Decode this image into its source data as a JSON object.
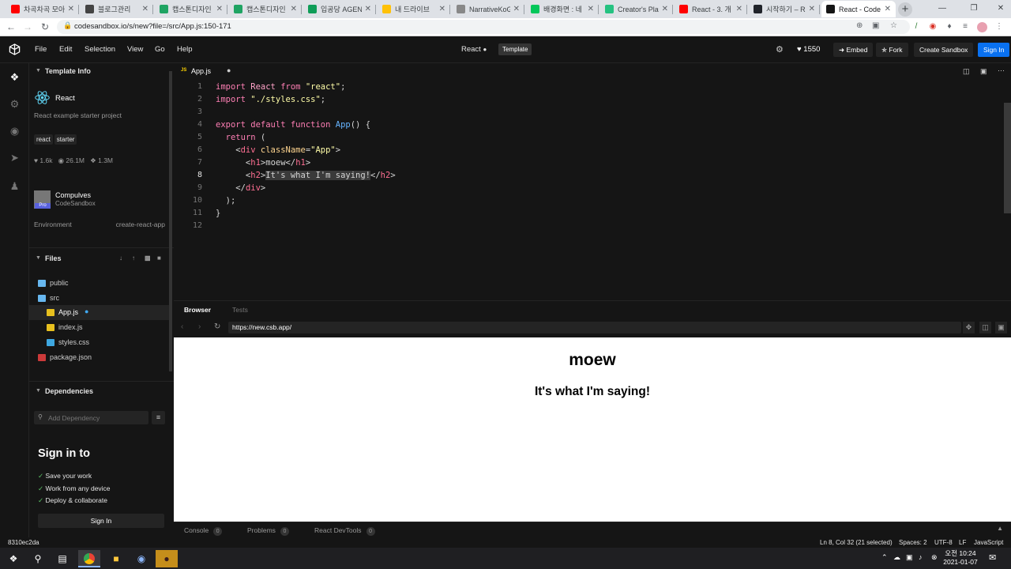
{
  "browser": {
    "tabs": [
      {
        "title": "차곡차곡 모아",
        "favicon": "youtube-icon",
        "color": "#ff0000"
      },
      {
        "title": "블로그관리",
        "favicon": "blog-icon",
        "color": "#444444"
      },
      {
        "title": "캡스톤디자인",
        "favicon": "google-drive-icon",
        "color": "#1fa463"
      },
      {
        "title": "캡스톤디자인",
        "favicon": "google-drive-icon",
        "color": "#1fa463"
      },
      {
        "title": "입공당 AGEN",
        "favicon": "google-sheets-icon",
        "color": "#0f9d58"
      },
      {
        "title": "내 드라이브",
        "favicon": "google-drive-icon",
        "color": "#ffc107"
      },
      {
        "title": "NarrativeKoG",
        "favicon": "github-icon",
        "color": "#888888"
      },
      {
        "title": "배경화면 : 네",
        "favicon": "naver-icon",
        "color": "#03c75a"
      },
      {
        "title": "Creator's Play",
        "favicon": "creator-icon",
        "color": "#25c281"
      },
      {
        "title": "React - 3. 개",
        "favicon": "youtube-icon",
        "color": "#ff0000"
      },
      {
        "title": "시작하기 – Re",
        "favicon": "react-docs-icon",
        "color": "#20232a"
      },
      {
        "title": "React - Code",
        "favicon": "codesandbox-icon",
        "color": "#151515",
        "active": true
      }
    ],
    "url": "codesandbox.io/s/new?file=/src/App.js:150-171"
  },
  "header": {
    "menu": [
      "File",
      "Edit",
      "Selection",
      "View",
      "Go",
      "Help"
    ],
    "sandbox_name": "React",
    "template_badge": "Template",
    "likes": "1550",
    "embed": "Embed",
    "fork": "Fork",
    "create_sandbox": "Create Sandbox",
    "sign_in": "Sign In"
  },
  "sidebar": {
    "template_info": {
      "heading": "Template Info",
      "name": "React",
      "description": "React example starter project",
      "tags": [
        "react",
        "starter"
      ],
      "stats": {
        "likes": "1.6k",
        "views": "26.1M",
        "forks": "1.3M"
      },
      "author": "Compulves",
      "author_sub": "CodeSandbox",
      "pro_badge": "Pro",
      "env_label": "Environment",
      "env_value": "create-react-app"
    },
    "files": {
      "heading": "Files",
      "items": [
        {
          "name": "public",
          "type": "folder"
        },
        {
          "name": "src",
          "type": "folder-open"
        },
        {
          "name": "App.js",
          "type": "js",
          "selected": true,
          "modified": true
        },
        {
          "name": "index.js",
          "type": "js"
        },
        {
          "name": "styles.css",
          "type": "css"
        },
        {
          "name": "package.json",
          "type": "json"
        }
      ]
    },
    "dependencies": {
      "heading": "Dependencies",
      "placeholder": "Add Dependency"
    },
    "signin_card": {
      "title": "Sign in to",
      "items": [
        "Save your work",
        "Work from any device",
        "Deploy & collaborate"
      ],
      "button": "Sign In"
    }
  },
  "editor": {
    "tab": "App.js",
    "tab_prefix": "JS",
    "line_numbers": [
      "1",
      "2",
      "3",
      "4",
      "5",
      "6",
      "7",
      "8",
      "9",
      "10",
      "11",
      "12"
    ],
    "active_line": 8
  },
  "preview": {
    "tabs": [
      "Browser",
      "Tests"
    ],
    "url": "https://new.csb.app/",
    "h1": "moew",
    "h2": "It's what I'm saying!"
  },
  "console": {
    "tabs": [
      {
        "label": "Console",
        "count": "0"
      },
      {
        "label": "Problems",
        "count": "0"
      },
      {
        "label": "React DevTools",
        "count": "0"
      }
    ]
  },
  "statusbar": {
    "commit": "8310ec2da",
    "cursor": "Ln 8, Col 32 (21 selected)",
    "spaces": "Spaces: 2",
    "encoding": "UTF-8",
    "eol": "LF",
    "language": "JavaScript"
  },
  "taskbar": {
    "time": "오전 10:24",
    "date": "2021-01-07"
  }
}
